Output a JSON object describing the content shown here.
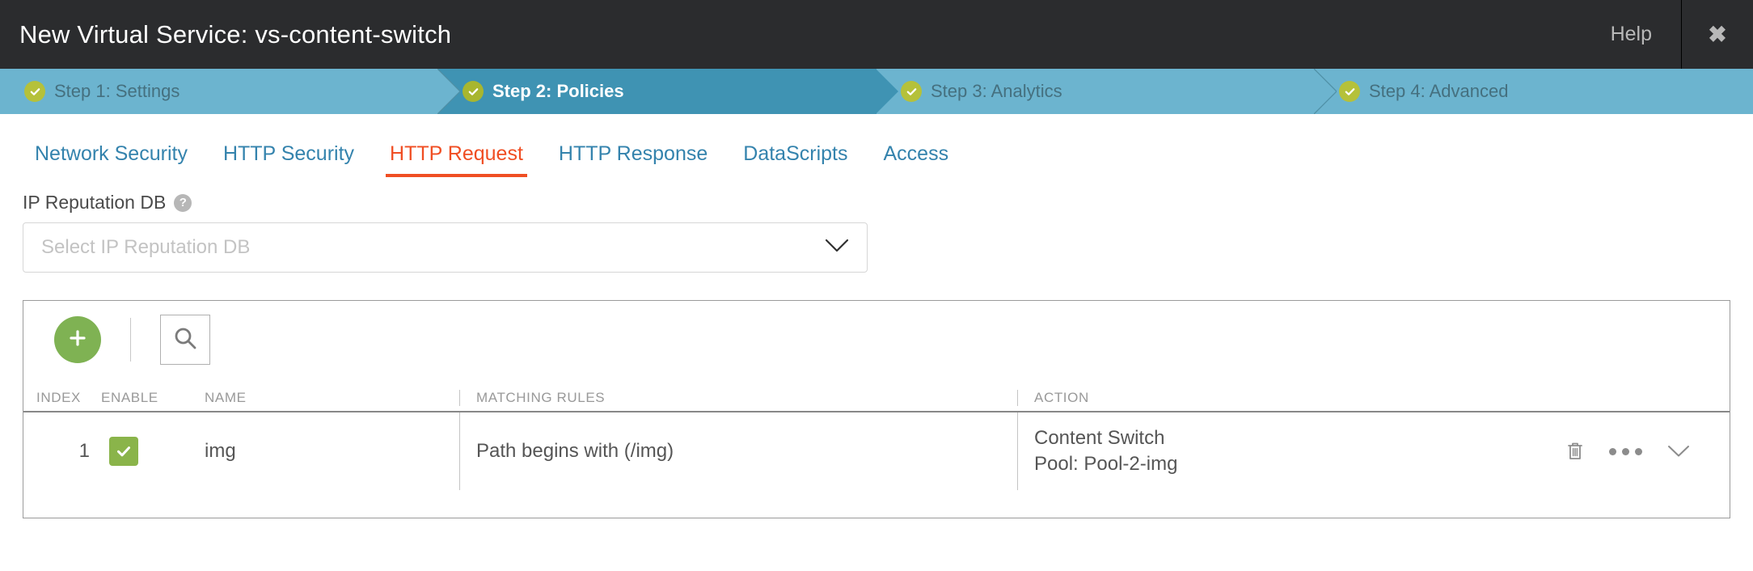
{
  "titlebar": {
    "title": "New Virtual Service: vs-content-switch",
    "help_label": "Help",
    "close_label": "✖"
  },
  "wizard": {
    "steps": [
      {
        "label": "Step 1: Settings",
        "state": "complete"
      },
      {
        "label": "Step 2: Policies",
        "state": "active"
      },
      {
        "label": "Step 3: Analytics",
        "state": "complete"
      },
      {
        "label": "Step 4: Advanced",
        "state": "complete"
      }
    ]
  },
  "tabs": [
    {
      "label": "Network Security",
      "active": false
    },
    {
      "label": "HTTP Security",
      "active": false
    },
    {
      "label": "HTTP Request",
      "active": true
    },
    {
      "label": "HTTP Response",
      "active": false
    },
    {
      "label": "DataScripts",
      "active": false
    },
    {
      "label": "Access",
      "active": false
    }
  ],
  "ip_reputation": {
    "label": "IP Reputation DB",
    "help_icon": "help-icon",
    "help_glyph": "?",
    "placeholder": "Select IP Reputation DB",
    "value": "",
    "chevron_icon": "chevron-down-icon"
  },
  "toolbar": {
    "add_icon": "plus-icon",
    "search_icon": "search-icon"
  },
  "table": {
    "columns": [
      "INDEX",
      "ENABLE",
      "NAME",
      "MATCHING RULES",
      "ACTION"
    ],
    "rows": [
      {
        "index": "1",
        "enabled": true,
        "name": "img",
        "matching_rules": "Path begins with (/img)",
        "action_line1": "Content Switch",
        "action_line2": "Pool: Pool-2-img",
        "icons": [
          "trash-icon",
          "ellipsis-icon",
          "chevron-down-icon"
        ]
      }
    ]
  },
  "colors": {
    "titlebar_bg": "#2b2c2e",
    "step_bg": "#6cb4cf",
    "step_active_bg": "#3f93b3",
    "step_check": "#b5c13a",
    "tab_link": "#3483ad",
    "tab_active": "#f04e23",
    "add_button": "#7fb253",
    "checkbox": "#8ab44a"
  }
}
